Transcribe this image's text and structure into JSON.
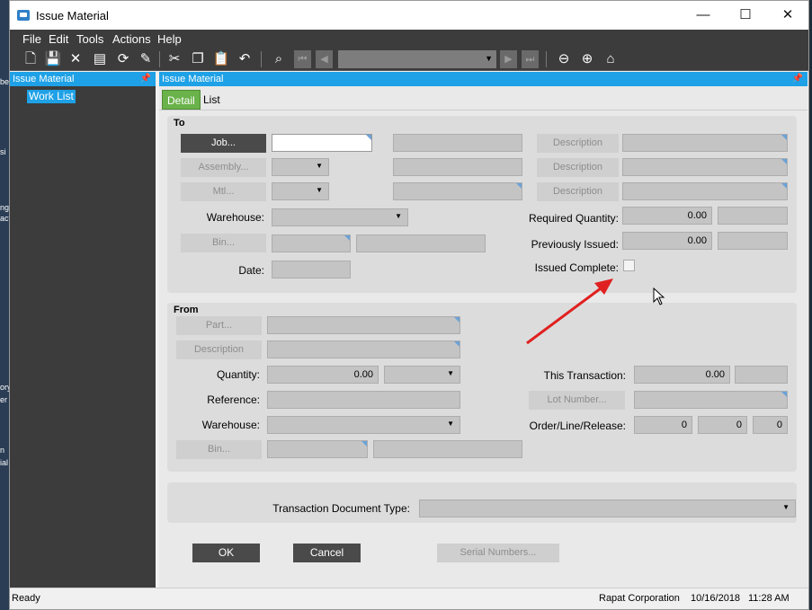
{
  "desktop": {
    "fragments": [
      "be",
      "si",
      "ng",
      "act",
      "ory",
      "er",
      "n",
      "ial"
    ]
  },
  "window": {
    "title": "Issue Material"
  },
  "window_controls": {
    "minimize": "—",
    "maximize": "☐",
    "close": "✕"
  },
  "menu": [
    "File",
    "Edit",
    "Tools",
    "Actions",
    "Help"
  ],
  "left_pane": {
    "header": "Issue Material",
    "items": [
      "Work List"
    ]
  },
  "right_pane": {
    "header": "Issue Material"
  },
  "tabs": [
    {
      "label": "Detail",
      "active": true
    },
    {
      "label": "List",
      "active": false
    }
  ],
  "to": {
    "title": "To",
    "job_button": "Job...",
    "assembly_button": "Assembly...",
    "mtl_button": "Mtl...",
    "warehouse_label": "Warehouse:",
    "bin_button": "Bin...",
    "date_label": "Date:",
    "description_labels": [
      "Description",
      "Description",
      "Description"
    ],
    "required_quantity_label": "Required Quantity:",
    "required_quantity": "0.00",
    "previously_issued_label": "Previously Issued:",
    "previously_issued": "0.00",
    "issued_complete_label": "Issued Complete:"
  },
  "from": {
    "title": "From",
    "part_button": "Part...",
    "description_button": "Description",
    "quantity_label": "Quantity:",
    "quantity": "0.00",
    "reference_label": "Reference:",
    "warehouse_label": "Warehouse:",
    "bin_button": "Bin...",
    "this_transaction_label": "This Transaction:",
    "this_transaction": "0.00",
    "lot_number_button": "Lot Number...",
    "order_line_release_label": "Order/Line/Release:",
    "order": "0",
    "line": "0",
    "release": "0"
  },
  "transaction_document_type_label": "Transaction Document Type:",
  "buttons": {
    "ok": "OK",
    "cancel": "Cancel",
    "serial_numbers": "Serial Numbers..."
  },
  "status": {
    "left": "Ready",
    "company": "Rapat Corporation",
    "date": "10/16/2018",
    "time": "11:28 AM"
  },
  "colors": {
    "accent": "#1ea1e6",
    "active_tab": "#6ab24a",
    "annotation_arrow": "#e02020"
  }
}
